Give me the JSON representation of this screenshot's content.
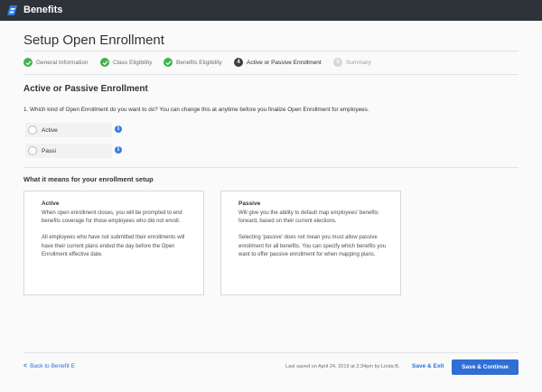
{
  "app": {
    "title": "Benefits"
  },
  "page": {
    "title": "Setup Open Enrollment"
  },
  "stepper": {
    "steps": [
      {
        "label": "General Information",
        "status": "done",
        "number": ""
      },
      {
        "label": "Class Eligibility",
        "status": "done",
        "number": ""
      },
      {
        "label": "Benefits Eligibility",
        "status": "done",
        "number": ""
      },
      {
        "label": "Active or Passive Enrollment",
        "status": "current",
        "number": "4"
      },
      {
        "label": "Summary",
        "status": "pending",
        "number": "5"
      }
    ]
  },
  "section": {
    "title": "Active or Passive Enrollment",
    "question": "1. Which kind of Open Enrollment do you want to do? You can change this at anytime before you finalize Open Enrollment for employees.",
    "options": [
      {
        "label": "Active"
      },
      {
        "label": "Passi"
      }
    ],
    "info_glyph": "i"
  },
  "explanation": {
    "title": "What it means for your enrollment setup",
    "active": {
      "title": "Active",
      "paragraphs": [
        "When open enrollment closes, you will be prompted to end benefits coverage for those employees who did not enroll.",
        "All employees who have not submitted their enrollments will have their current plans ended the day before the Open Enrollment effective date."
      ]
    },
    "passive": {
      "title": "Passive",
      "paragraphs": [
        "Will give you the ability to default map employees' benefits forward, based on their current elections.",
        "Selecting 'passive' does not mean you must allow passive enrollment for all benefits. You can specify which benefits you want to offer passive enrollment for when mapping plans."
      ]
    }
  },
  "footer": {
    "back_label": "Back to Benefit E",
    "back_chevron": "<",
    "last_saved": "Last saved on April 24, 2019 at 2:34pm by Linda B.",
    "save_exit_label": "Save & Exit",
    "save_continue_label": "Save & Continue"
  },
  "colors": {
    "topbar": "#2e3239",
    "accent": "#2f6fd6",
    "done": "#3fb34f",
    "logo": "#2f7de1"
  },
  "icons": {
    "logo": "benefits-logo-icon",
    "check": "checkmark-icon",
    "info": "info-icon",
    "back": "chevron-left-icon"
  }
}
